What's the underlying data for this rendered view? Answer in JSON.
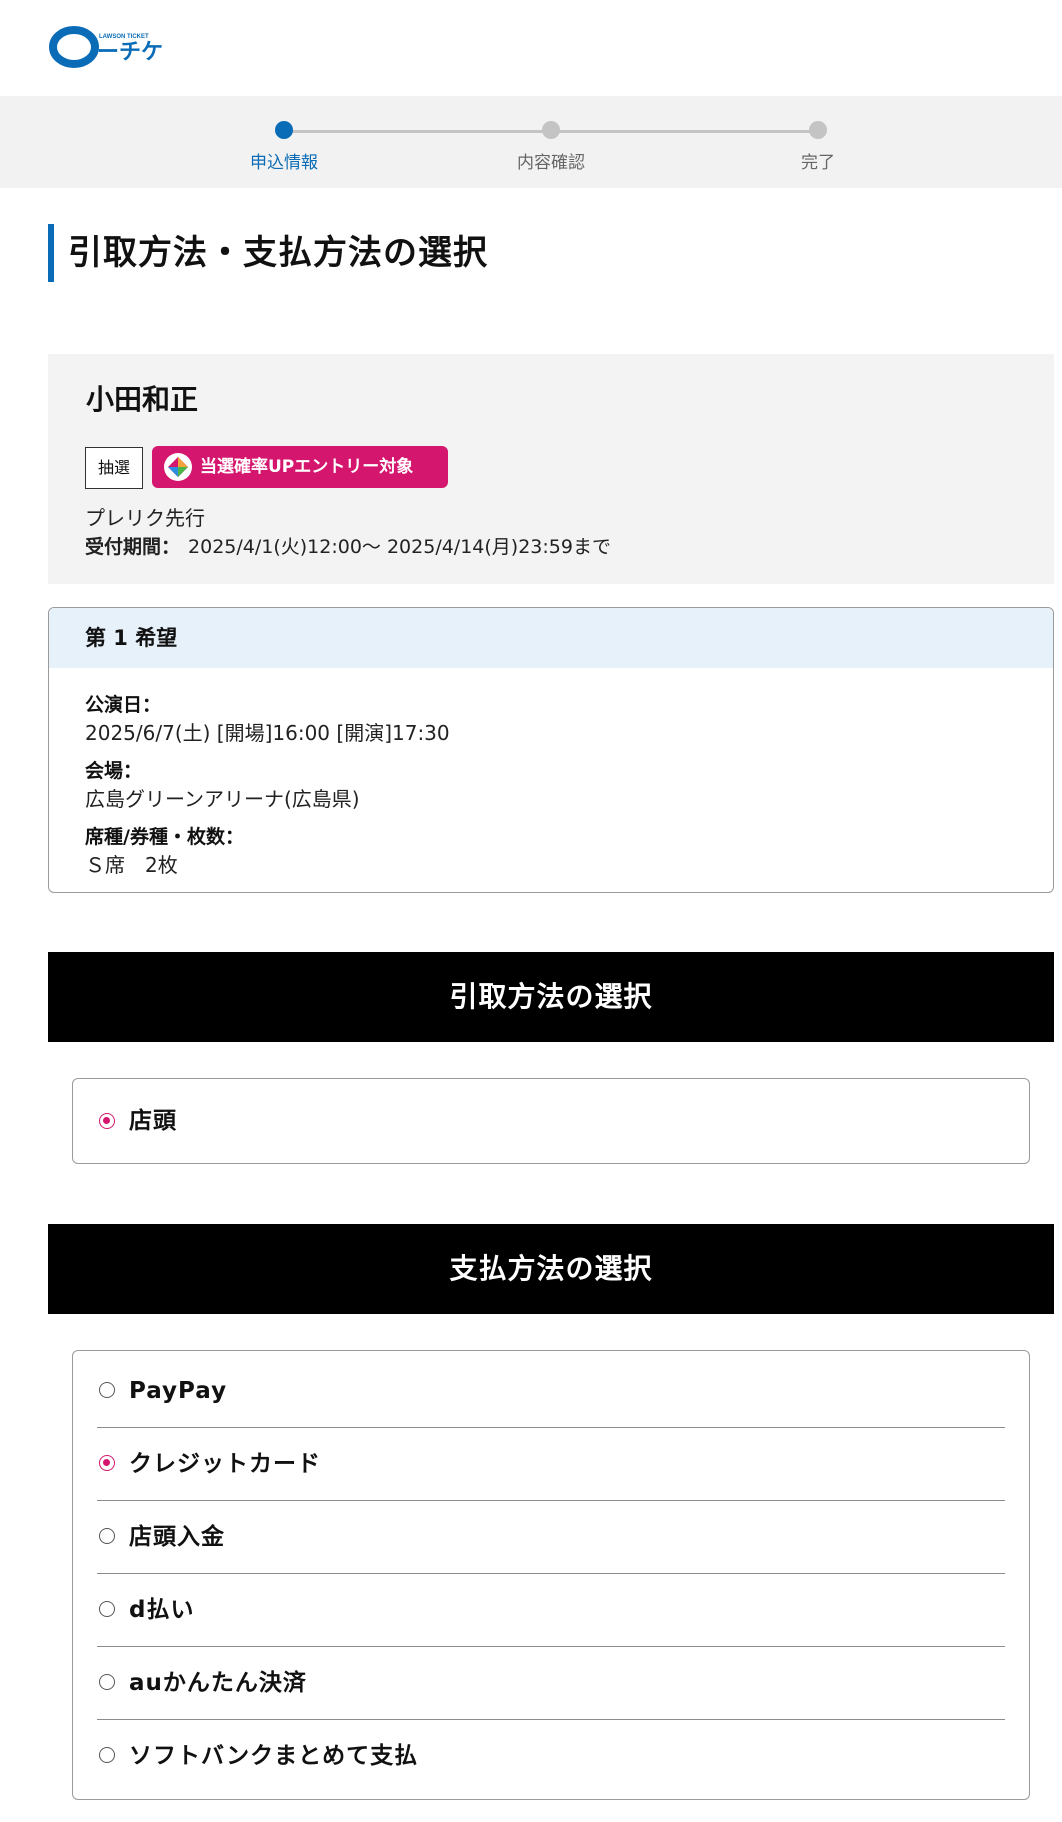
{
  "brand": {
    "logo_text": "LAWSON TICKET",
    "logo_sub": "ーチケ",
    "accent": "#0a6cb6",
    "pink": "#d5166e"
  },
  "progress": {
    "steps": [
      {
        "label": "申込情報",
        "active": true
      },
      {
        "label": "内容確認",
        "active": false
      },
      {
        "label": "完了",
        "active": false
      }
    ]
  },
  "page_title": "引取方法・支払方法の選択",
  "event": {
    "artist": "小田和正",
    "badge_lottery": "抽選",
    "badge_up": "当選確率UPエントリー対象",
    "sale_type": "プレリク先行",
    "period_label": "受付期間：",
    "period_value": "2025/4/1(火)12:00～ 2025/4/14(月)23:59まで"
  },
  "preference": {
    "heading": "第 1 希望",
    "date_label": "公演日：",
    "date_value": "2025/6/7(土) [開場]16:00 [開演]17:30",
    "venue_label": "会場：",
    "venue_value": "広島グリーンアリーナ(広島県)",
    "seat_label": "席種/券種・枚数：",
    "seat_value": "Ｓ席　2枚"
  },
  "pickup": {
    "heading": "引取方法の選択",
    "options": [
      {
        "label": "店頭",
        "selected": true
      }
    ]
  },
  "payment": {
    "heading": "支払方法の選択",
    "options": [
      {
        "label": "PayPay",
        "selected": false
      },
      {
        "label": "クレジットカード",
        "selected": true
      },
      {
        "label": "店頭入金",
        "selected": false
      },
      {
        "label": "d払い",
        "selected": false
      },
      {
        "label": "auかんたん決済",
        "selected": false
      },
      {
        "label": "ソフトバンクまとめて支払",
        "selected": false
      }
    ]
  }
}
